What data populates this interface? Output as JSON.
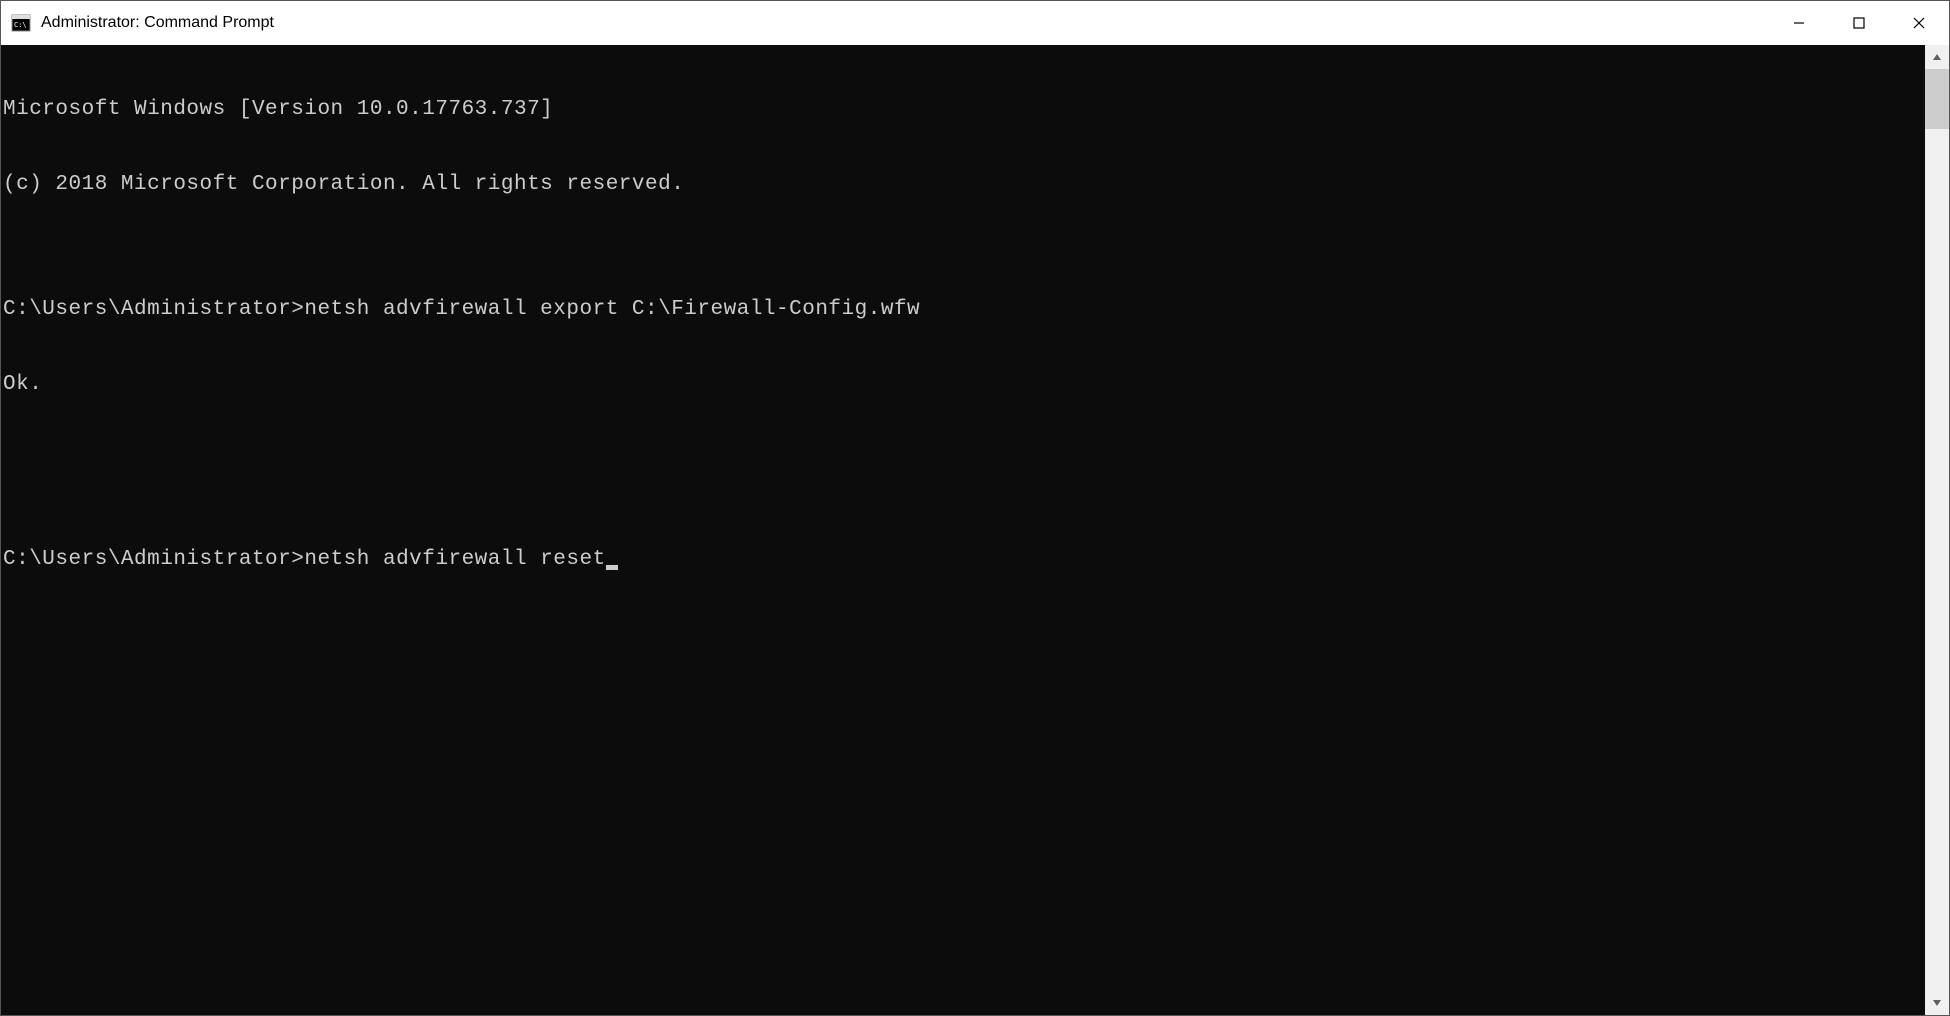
{
  "window": {
    "title": "Administrator: Command Prompt"
  },
  "terminal": {
    "lines": [
      "Microsoft Windows [Version 10.0.17763.737]",
      "(c) 2018 Microsoft Corporation. All rights reserved.",
      "",
      "C:\\Users\\Administrator>netsh advfirewall export C:\\Firewall-Config.wfw",
      "Ok.",
      "",
      ""
    ],
    "current_prompt": "C:\\Users\\Administrator>",
    "current_command": "netsh advfirewall reset"
  }
}
